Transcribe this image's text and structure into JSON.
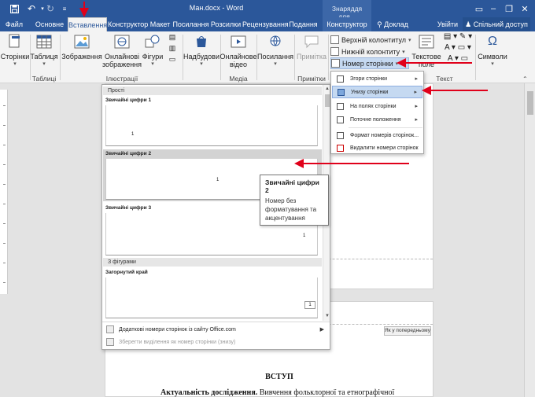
{
  "titlebar": {
    "doc_title": "Ман.docx - Word",
    "tools_label": "Знаряддя для...",
    "save_icon": "save-icon",
    "undo_icon": "undo-icon",
    "redo_icon": "redo-icon"
  },
  "tabs": {
    "file": "Файл",
    "home": "Основне",
    "insert": "Вставлення",
    "design": "Конструктор",
    "layout": "Макет",
    "references": "Посилання",
    "mailings": "Розсилки",
    "review": "Рецензування",
    "view": "Подання",
    "hf_design": "Конструктор",
    "tell_me": "Доклад",
    "signin": "Увійти",
    "share": "Спільний доступ"
  },
  "ribbon": {
    "pages": "Сторінки",
    "table": "Таблиця",
    "pictures": "Зображення",
    "online_pictures_1": "Онлайнові",
    "online_pictures_2": "зображення",
    "shapes": "Фігури",
    "addins": "Надбудови",
    "online_video_1": "Онлайнове",
    "online_video_2": "відео",
    "links": "Посилання",
    "comment": "Примітка",
    "header": "Верхній колонтитул",
    "footer": "Нижній колонтиту",
    "page_number": "Номер сторінки",
    "textbox_1": "Текстове",
    "textbox_2": "поле",
    "symbols": "Символи",
    "group_tables": "Таблиці",
    "group_illustrations": "Ілюстрації",
    "group_media": "Медіа",
    "group_comments": "Примітки",
    "group_text": "Текст"
  },
  "gallery": {
    "section_simple": "Прості",
    "items": [
      {
        "title": "Звичайні цифри 1",
        "num": "1"
      },
      {
        "title": "Звичайні цифри 2",
        "num": "1"
      },
      {
        "title": "Звичайні цифри 3",
        "num": "1"
      }
    ],
    "section_shapes": "З фігурами",
    "item_folded": {
      "title": "Загорнутий край",
      "num": "1"
    },
    "more_numbers": "Додаткові номери сторінок із сайту Office.com",
    "save_selection": "Зберегти виділення як номер сторінки (знизу)"
  },
  "page_number_menu": {
    "top": "Згори сторінки",
    "bottom": "Унизу сторінки",
    "margins": "На полях сторінки",
    "current": "Поточне положення",
    "format": "Формат номерів сторінок...",
    "remove": "Видалити номери сторінок"
  },
  "tooltip": {
    "title": "Звичайні цифри 2",
    "description": "Номер без форматування та акцентування"
  },
  "document": {
    "same_as_previous": "Як у попередньому",
    "heading": "ВСТУП",
    "para_bold": "Актуальність дослідження.",
    "para_rest": " Вивчення фольклорної та етнографічної"
  },
  "colors": {
    "word_blue": "#2b579a",
    "annotation_red": "#e0001a"
  }
}
